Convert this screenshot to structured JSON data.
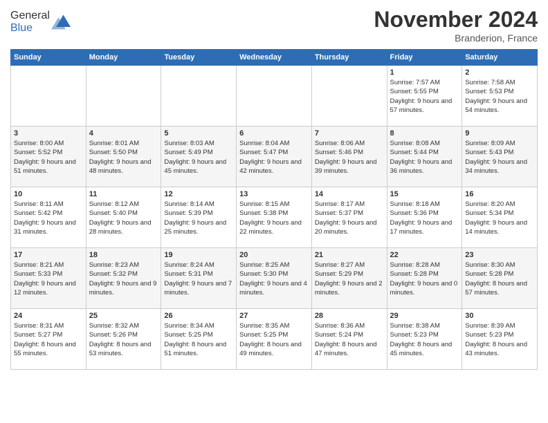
{
  "header": {
    "logo_line1": "General",
    "logo_line2": "Blue",
    "month": "November 2024",
    "location": "Branderion, France"
  },
  "weekdays": [
    "Sunday",
    "Monday",
    "Tuesday",
    "Wednesday",
    "Thursday",
    "Friday",
    "Saturday"
  ],
  "weeks": [
    [
      {
        "day": "",
        "info": ""
      },
      {
        "day": "",
        "info": ""
      },
      {
        "day": "",
        "info": ""
      },
      {
        "day": "",
        "info": ""
      },
      {
        "day": "",
        "info": ""
      },
      {
        "day": "1",
        "info": "Sunrise: 7:57 AM\nSunset: 5:55 PM\nDaylight: 9 hours and 57 minutes."
      },
      {
        "day": "2",
        "info": "Sunrise: 7:58 AM\nSunset: 5:53 PM\nDaylight: 9 hours and 54 minutes."
      }
    ],
    [
      {
        "day": "3",
        "info": "Sunrise: 8:00 AM\nSunset: 5:52 PM\nDaylight: 9 hours and 51 minutes."
      },
      {
        "day": "4",
        "info": "Sunrise: 8:01 AM\nSunset: 5:50 PM\nDaylight: 9 hours and 48 minutes."
      },
      {
        "day": "5",
        "info": "Sunrise: 8:03 AM\nSunset: 5:49 PM\nDaylight: 9 hours and 45 minutes."
      },
      {
        "day": "6",
        "info": "Sunrise: 8:04 AM\nSunset: 5:47 PM\nDaylight: 9 hours and 42 minutes."
      },
      {
        "day": "7",
        "info": "Sunrise: 8:06 AM\nSunset: 5:46 PM\nDaylight: 9 hours and 39 minutes."
      },
      {
        "day": "8",
        "info": "Sunrise: 8:08 AM\nSunset: 5:44 PM\nDaylight: 9 hours and 36 minutes."
      },
      {
        "day": "9",
        "info": "Sunrise: 8:09 AM\nSunset: 5:43 PM\nDaylight: 9 hours and 34 minutes."
      }
    ],
    [
      {
        "day": "10",
        "info": "Sunrise: 8:11 AM\nSunset: 5:42 PM\nDaylight: 9 hours and 31 minutes."
      },
      {
        "day": "11",
        "info": "Sunrise: 8:12 AM\nSunset: 5:40 PM\nDaylight: 9 hours and 28 minutes."
      },
      {
        "day": "12",
        "info": "Sunrise: 8:14 AM\nSunset: 5:39 PM\nDaylight: 9 hours and 25 minutes."
      },
      {
        "day": "13",
        "info": "Sunrise: 8:15 AM\nSunset: 5:38 PM\nDaylight: 9 hours and 22 minutes."
      },
      {
        "day": "14",
        "info": "Sunrise: 8:17 AM\nSunset: 5:37 PM\nDaylight: 9 hours and 20 minutes."
      },
      {
        "day": "15",
        "info": "Sunrise: 8:18 AM\nSunset: 5:36 PM\nDaylight: 9 hours and 17 minutes."
      },
      {
        "day": "16",
        "info": "Sunrise: 8:20 AM\nSunset: 5:34 PM\nDaylight: 9 hours and 14 minutes."
      }
    ],
    [
      {
        "day": "17",
        "info": "Sunrise: 8:21 AM\nSunset: 5:33 PM\nDaylight: 9 hours and 12 minutes."
      },
      {
        "day": "18",
        "info": "Sunrise: 8:23 AM\nSunset: 5:32 PM\nDaylight: 9 hours and 9 minutes."
      },
      {
        "day": "19",
        "info": "Sunrise: 8:24 AM\nSunset: 5:31 PM\nDaylight: 9 hours and 7 minutes."
      },
      {
        "day": "20",
        "info": "Sunrise: 8:25 AM\nSunset: 5:30 PM\nDaylight: 9 hours and 4 minutes."
      },
      {
        "day": "21",
        "info": "Sunrise: 8:27 AM\nSunset: 5:29 PM\nDaylight: 9 hours and 2 minutes."
      },
      {
        "day": "22",
        "info": "Sunrise: 8:28 AM\nSunset: 5:28 PM\nDaylight: 9 hours and 0 minutes."
      },
      {
        "day": "23",
        "info": "Sunrise: 8:30 AM\nSunset: 5:28 PM\nDaylight: 8 hours and 57 minutes."
      }
    ],
    [
      {
        "day": "24",
        "info": "Sunrise: 8:31 AM\nSunset: 5:27 PM\nDaylight: 8 hours and 55 minutes."
      },
      {
        "day": "25",
        "info": "Sunrise: 8:32 AM\nSunset: 5:26 PM\nDaylight: 8 hours and 53 minutes."
      },
      {
        "day": "26",
        "info": "Sunrise: 8:34 AM\nSunset: 5:25 PM\nDaylight: 8 hours and 51 minutes."
      },
      {
        "day": "27",
        "info": "Sunrise: 8:35 AM\nSunset: 5:25 PM\nDaylight: 8 hours and 49 minutes."
      },
      {
        "day": "28",
        "info": "Sunrise: 8:36 AM\nSunset: 5:24 PM\nDaylight: 8 hours and 47 minutes."
      },
      {
        "day": "29",
        "info": "Sunrise: 8:38 AM\nSunset: 5:23 PM\nDaylight: 8 hours and 45 minutes."
      },
      {
        "day": "30",
        "info": "Sunrise: 8:39 AM\nSunset: 5:23 PM\nDaylight: 8 hours and 43 minutes."
      }
    ]
  ]
}
